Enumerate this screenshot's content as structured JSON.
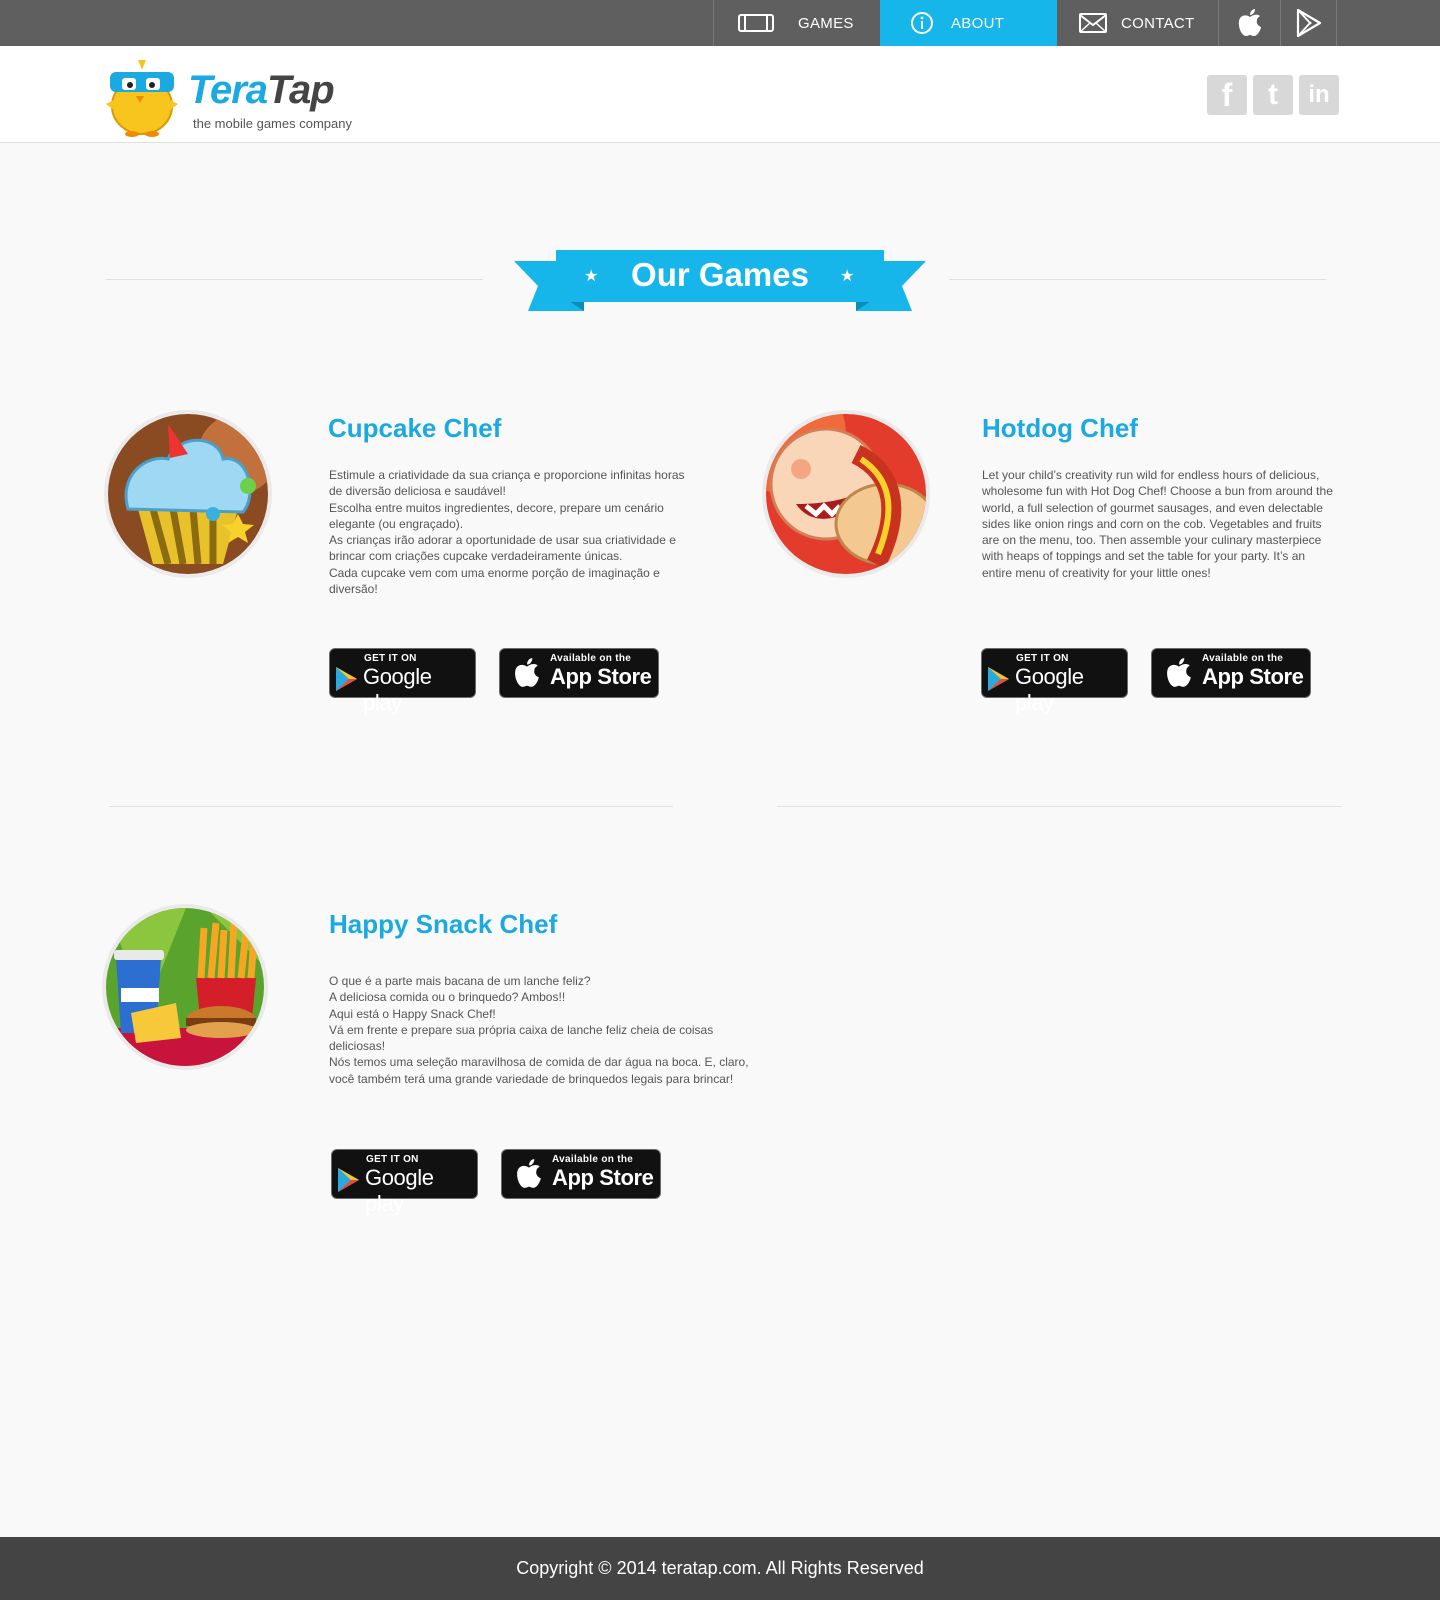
{
  "nav": {
    "games": "GAMES",
    "about": "ABOUT",
    "contact": "CONTACT",
    "active": "about",
    "accent_color": "#16b6ea"
  },
  "header": {
    "logo_word_a": "Tera",
    "logo_word_b": "Tap",
    "tagline": "the mobile games company",
    "social": [
      "facebook-icon",
      "twitter-icon",
      "linkedin-icon"
    ]
  },
  "section": {
    "title": "Our Games"
  },
  "badges": {
    "google_small": "GET IT ON",
    "google_big": "Google play",
    "apple_small": "Available on the",
    "apple_big": "App Store"
  },
  "games": [
    {
      "title": "Cupcake Chef",
      "description": "Estimule a criatividade da sua criança e proporcione infinitas horas de diversão deliciosa e saudável!\nEscolha entre muitos ingredientes, decore, prepare um cenário elegante (ou engraçado).\nAs crianças irão adorar a oportunidade de usar sua criatividade e brincar com criações cupcake verdadeiramente únicas.\nCada cupcake vem com uma enorme porção de imaginação e diversão!"
    },
    {
      "title": "Hotdog Chef",
      "description": "Let your child’s creativity run wild for endless hours of delicious, wholesome fun with Hot Dog Chef! Choose a bun from around the world, a full selection of gourmet sausages, and even delectable sides like onion rings and corn on the cob. Vegetables and fruits are on the menu, too. Then assemble your culinary masterpiece with heaps of toppings and set the table for your party. It’s an entire menu of creativity for your little ones!"
    },
    {
      "title": "Happy Snack Chef",
      "description": "O que é a parte mais bacana de um lanche feliz?\nA deliciosa comida ou o brinquedo? Ambos!!\nAqui está o Happy Snack Chef!\nVá em frente e prepare sua própria caixa de lanche feliz cheia de coisas deliciosas!\nNós temos uma seleção maravilhosa de comida de dar água na boca. E, claro, você também terá uma grande variedade de brinquedos legais para brincar!"
    }
  ],
  "footer": {
    "copyright": "Copyright © 2014 teratap.com. All Rights Reserved"
  }
}
